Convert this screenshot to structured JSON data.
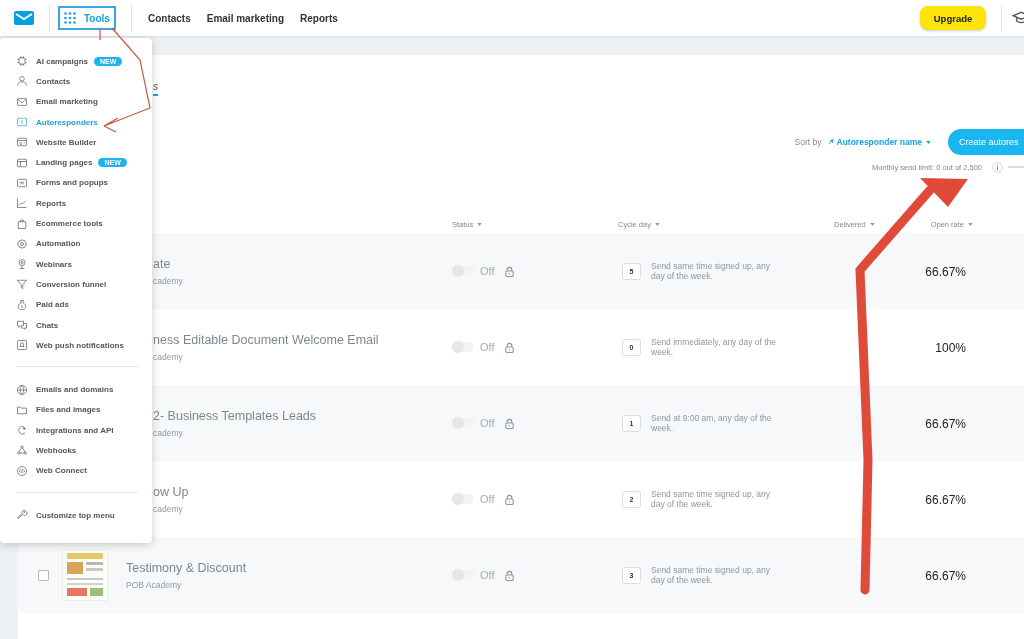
{
  "topbar": {
    "tools": {
      "label": "Tools",
      "selected": true
    },
    "nav": [
      "Contacts",
      "Email marketing",
      "Reports"
    ],
    "upgrade": "Upgrade"
  },
  "tools_menu": {
    "groups": [
      [
        {
          "label": "AI campaigns",
          "badge": "NEW",
          "selected": false
        },
        {
          "label": "Contacts",
          "selected": false
        },
        {
          "label": "Email marketing",
          "selected": false
        },
        {
          "label": "Autoresponders",
          "selected": true
        },
        {
          "label": "Website Builder",
          "selected": false
        },
        {
          "label": "Landing pages",
          "badge": "NEW",
          "selected": false
        },
        {
          "label": "Forms and popups",
          "selected": false
        },
        {
          "label": "Reports",
          "selected": false
        },
        {
          "label": "Ecommerce tools",
          "selected": false
        },
        {
          "label": "Automation",
          "selected": false
        },
        {
          "label": "Webinars",
          "selected": false
        },
        {
          "label": "Conversion funnel",
          "selected": false
        },
        {
          "label": "Paid ads",
          "selected": false
        },
        {
          "label": "Chats",
          "selected": false
        },
        {
          "label": "Web push notifications",
          "selected": false
        }
      ],
      [
        {
          "label": "Emails and domains",
          "selected": false
        },
        {
          "label": "Files and images",
          "selected": false
        },
        {
          "label": "Integrations and API",
          "selected": false
        },
        {
          "label": "Webhooks",
          "selected": false
        },
        {
          "label": "Web Connect",
          "selected": false
        }
      ],
      [
        {
          "label": "Customize top menu",
          "selected": false
        }
      ]
    ]
  },
  "tabs": [
    {
      "label": "s",
      "selected": true
    }
  ],
  "sort": {
    "label": "Sort by",
    "value": "Autoresponder name"
  },
  "create_button": "Create autores",
  "send_limit": "Monthly send limit: 0 out of 2,500",
  "table": {
    "columns": [
      "Status",
      "Cycle day",
      "Delivered",
      "Open rate"
    ],
    "rows": [
      {
        "name": "ate",
        "sub": "cademy",
        "on": false,
        "status": "Off",
        "day": "5",
        "cycle": "Send same time signed up, any day of the week.",
        "open_rate": "66.67%"
      },
      {
        "name": "ness Editable Document Welcome Email",
        "sub": "cademy",
        "on": false,
        "status": "Off",
        "day": "0",
        "cycle": "Send immediately, any day of the week.",
        "open_rate": "100%"
      },
      {
        "name": "2- Business Templates Leads",
        "sub": "cademy",
        "on": false,
        "status": "Off",
        "day": "1",
        "cycle": "Send at 9:00 am, any day of the week.",
        "open_rate": "66.67%"
      },
      {
        "name": "ow Up",
        "sub": "cademy",
        "on": false,
        "status": "Off",
        "day": "2",
        "cycle": "Send same time signed up, any day of the week.",
        "open_rate": "66.67%"
      },
      {
        "name": "Testimony & Discount",
        "sub": "POB Academy",
        "checked": false,
        "on": false,
        "status": "Off",
        "day": "3",
        "cycle": "Send same time signed up, any day of the week.",
        "open_rate": "66.67%"
      }
    ]
  }
}
